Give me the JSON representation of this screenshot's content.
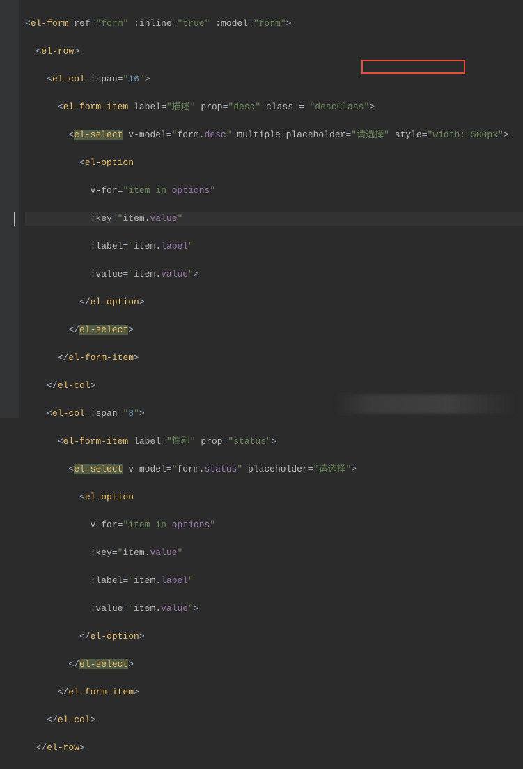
{
  "lines": {
    "l1_tag": "el-form",
    "l1_a1": "ref",
    "l1_v1": "form",
    "l1_a2": ":inline",
    "l1_v2": "true",
    "l1_a3": ":model",
    "l1_v3": "form",
    "l2_tag": "el-row",
    "l3_tag": "el-col",
    "l3_a1": ":span",
    "l3_v1": "16",
    "l4_tag": "el-form-item",
    "l4_a1": "label",
    "l4_v1": "描述",
    "l4_a2": "prop",
    "l4_v2": "desc",
    "l4_a3": "class",
    "l4_v3": "descClass",
    "l5_tag": "el-select",
    "l5_a1": "v-model",
    "l5_obj": "form",
    "l5_prop": "desc",
    "l5_a2": "multiple",
    "l5_a3": "placeholder",
    "l5_v3": "请选择",
    "l5_a4": "style",
    "l5_v4": "width: 500px",
    "l6_tag": "el-option",
    "l7_a": "v-for",
    "l7_v": "item in ",
    "l7_prop": "options",
    "l8_a": ":key",
    "l8_obj": "item",
    "l8_prop": "value",
    "l9_a": ":label",
    "l9_obj": "item",
    "l9_prop": "label",
    "l10_a": ":value",
    "l10_obj": "item",
    "l10_prop": "value",
    "l11_tag": "el-option",
    "l12_tag": "el-select",
    "l13_tag": "el-form-item",
    "l14_tag": "el-col",
    "l15_tag": "el-col",
    "l15_a1": ":span",
    "l15_v1": "8",
    "l16_tag": "el-form-item",
    "l16_a1": "label",
    "l16_v1": "性别",
    "l16_a2": "prop",
    "l16_v2": "status",
    "l17_tag": "el-select",
    "l17_a1": "v-model",
    "l17_obj": "form",
    "l17_prop": "status",
    "l17_a2": "placeholder",
    "l17_v2": "请选择",
    "l18_tag": "el-option",
    "l19_a": "v-for",
    "l19_v": "item in ",
    "l19_prop": "options",
    "l20_a": ":key",
    "l20_obj": "item",
    "l20_prop": "value",
    "l21_a": ":label",
    "l21_obj": "item",
    "l21_prop": "label",
    "l22_a": ":value",
    "l22_obj": "item",
    "l22_prop": "value",
    "l23_tag": "el-option",
    "l24_tag": "el-select",
    "l25_tag": "el-form-item",
    "l26_tag": "el-col",
    "l27_tag": "el-row"
  }
}
